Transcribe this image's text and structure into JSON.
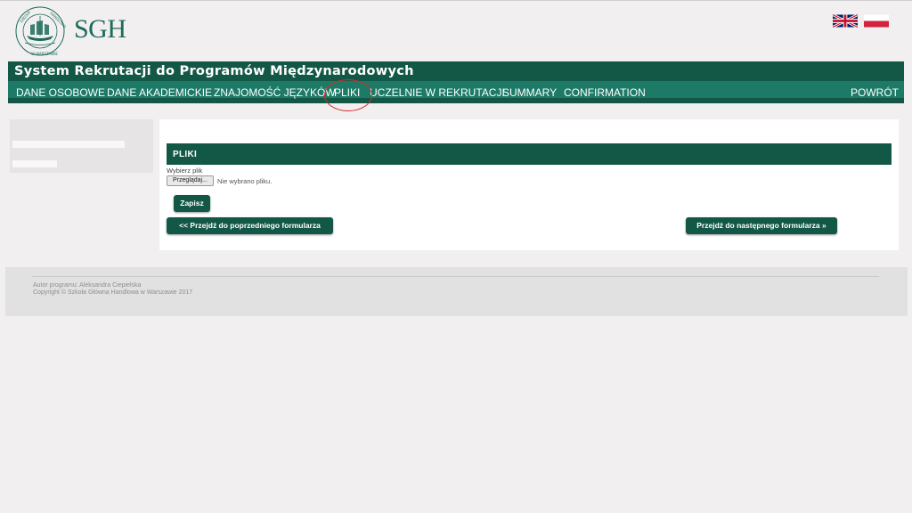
{
  "header": {
    "logo_text": "SGH",
    "seal_text": "SZKOŁA GŁÓWNA HANDLOWA W WARSZAWIE"
  },
  "languages": [
    {
      "name": "english-flag"
    },
    {
      "name": "polish-flag"
    }
  ],
  "title": "System Rekrutacji do Programów Międzynarodowych",
  "nav": {
    "items": [
      {
        "label": "DANE OSOBOWE"
      },
      {
        "label": "DANE AKADEMICKIE"
      },
      {
        "label": "ZNAJOMOŚĆ JĘZYKÓW"
      },
      {
        "label": "PLIKI"
      },
      {
        "label": "UCZELNIE W REKRUTACJI"
      },
      {
        "label": "SUMMARY"
      },
      {
        "label": "CONFIRMATION"
      }
    ],
    "back_label": "POWRÓT",
    "highlighted": "PLIKI"
  },
  "main": {
    "section_title": "PLIKI",
    "file_label": "Wybierz plik",
    "browse_label": "Przeglądaj...",
    "no_file_text": "Nie wybrano pliku.",
    "save_label": "Zapisz",
    "prev_label": "<< Przejdź do poprzedniego formularza",
    "next_label": "Przejdź do następnego formularza »"
  },
  "footer": {
    "author": "Autor programu: Aleksandra Ciepielska",
    "copyright": "Copyright © Szkoła Główna Handlowa w Warszawie 2017"
  },
  "colors": {
    "brand_dark": "#135846",
    "brand_nav": "#1c7a66",
    "highlight_circle": "#d62f2f",
    "page_bg": "#f1eff0"
  }
}
